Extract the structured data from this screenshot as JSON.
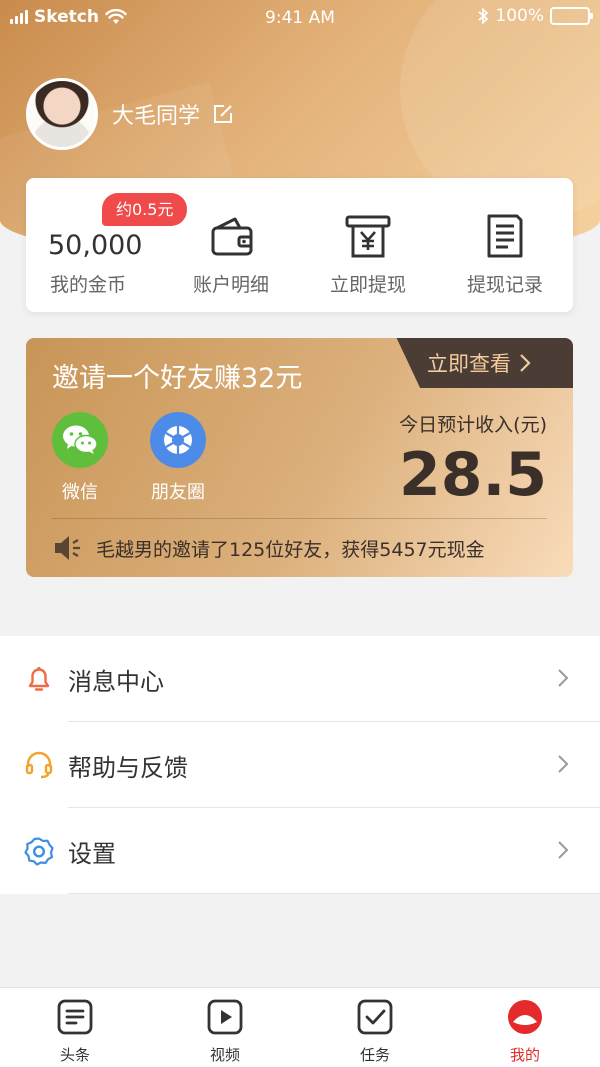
{
  "status_bar": {
    "carrier": "Sketch",
    "time": "9:41 AM",
    "battery": "100%"
  },
  "profile": {
    "name": "大毛同学"
  },
  "wallet_card": {
    "coins_value": "50,000",
    "coins_label": "我的金币",
    "coins_badge": "约0.5元",
    "items": [
      {
        "label": "账户明细",
        "icon": "wallet-icon"
      },
      {
        "label": "立即提现",
        "icon": "withdraw-icon"
      },
      {
        "label": "提现记录",
        "icon": "record-icon"
      }
    ]
  },
  "invite": {
    "title": "邀请一个好友赚32元",
    "view_now": "立即查看",
    "share": [
      {
        "label": "微信",
        "icon": "wechat-icon",
        "color": "#5fbf3c"
      },
      {
        "label": "朋友圈",
        "icon": "moments-icon",
        "color": "#4d8be8"
      }
    ],
    "estimate_label": "今日预计收入(元)",
    "estimate_value": "28.5",
    "notice": "毛越男的邀请了125位好友，获得5457元现金"
  },
  "menu": [
    {
      "label": "消息中心",
      "icon": "bell-icon",
      "color": "#f06b43"
    },
    {
      "label": "帮助与反馈",
      "icon": "headset-icon",
      "color": "#f3a22c"
    },
    {
      "label": "设置",
      "icon": "gear-icon",
      "color": "#3e8fe5"
    }
  ],
  "tabbar": [
    {
      "label": "头条",
      "icon": "headlines-icon",
      "active": false
    },
    {
      "label": "视频",
      "icon": "video-icon",
      "active": false
    },
    {
      "label": "任务",
      "icon": "task-icon",
      "active": false
    },
    {
      "label": "我的",
      "icon": "mine-icon",
      "active": true
    }
  ],
  "colors": {
    "accent": "#e42a2a",
    "gold": "#d9a86a",
    "dark": "#4b3d36"
  }
}
